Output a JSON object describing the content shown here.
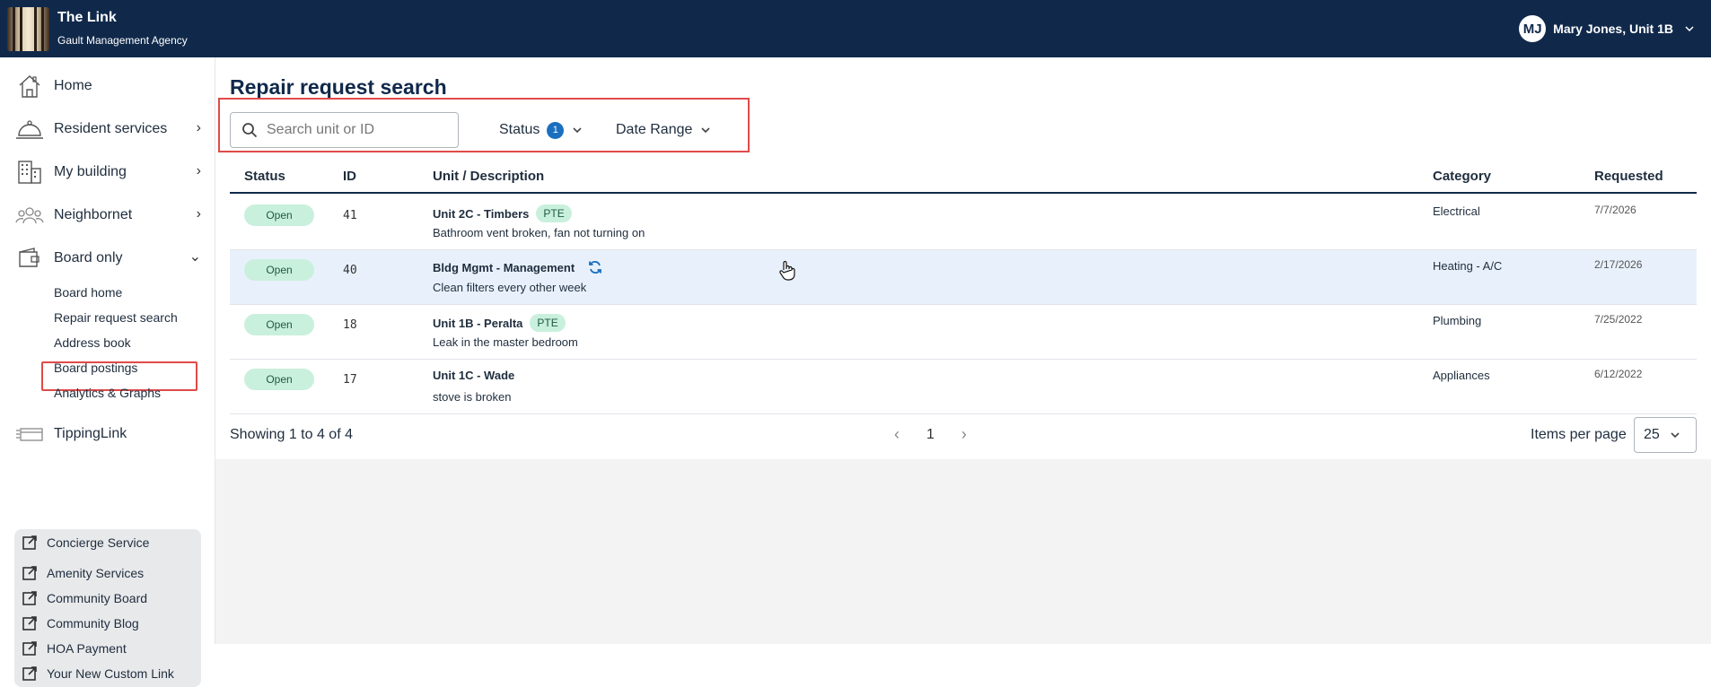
{
  "app": {
    "title": "The Link",
    "subtitle": "Gault Management Agency"
  },
  "user": {
    "initials": "MJ",
    "name": "Mary Jones, Unit 1B"
  },
  "sidebar": {
    "items": [
      {
        "label": "Home",
        "icon": "house-icon"
      },
      {
        "label": "Resident services",
        "icon": "service-bell-icon"
      },
      {
        "label": "My building",
        "icon": "building-icon"
      },
      {
        "label": "Neighbornet",
        "icon": "people-icon"
      },
      {
        "label": "Board only",
        "icon": "wallet-icon"
      },
      {
        "label": "TippingLink",
        "icon": "card-icon"
      }
    ],
    "board_sub": [
      "Board home",
      "Repair request search",
      "Address book",
      "Board postings",
      "Analytics & Graphs"
    ],
    "links": [
      "Concierge Service",
      "Amenity Services",
      "Community Board",
      "Community Blog",
      "HOA Payment",
      "Your New Custom Link"
    ]
  },
  "page": {
    "title": "Repair request search",
    "search_placeholder": "Search unit or ID",
    "status_filter": "Status",
    "status_count": "1",
    "date_filter": "Date Range"
  },
  "table": {
    "headers": {
      "status": "Status",
      "id": "ID",
      "unit": "Unit / Description",
      "category": "Category",
      "requested": "Requested"
    },
    "rows": [
      {
        "status": "Open",
        "id": "41",
        "unit": "Unit 2C - Timbers",
        "tag": "PTE",
        "desc": "Bathroom vent broken, fan not turning on",
        "category": "Electrical",
        "date": "7/7/2026"
      },
      {
        "status": "Open",
        "id": "40",
        "unit": "Bldg Mgmt - Management",
        "tag": "",
        "desc": "Clean filters every other week",
        "category": "Heating - A/C",
        "date": "2/17/2026"
      },
      {
        "status": "Open",
        "id": "18",
        "unit": "Unit 1B - Peralta",
        "tag": "PTE",
        "desc": "Leak in the master bedroom",
        "category": "Plumbing",
        "date": "7/25/2022"
      },
      {
        "status": "Open",
        "id": "17",
        "unit": "Unit 1C - Wade",
        "tag": "",
        "desc": "stove is broken",
        "category": "Appliances",
        "date": "6/12/2022"
      }
    ]
  },
  "footer": {
    "showing": "Showing 1 to 4 of 4",
    "page": "1",
    "ipp_label": "Items per page",
    "ipp_value": "25"
  }
}
